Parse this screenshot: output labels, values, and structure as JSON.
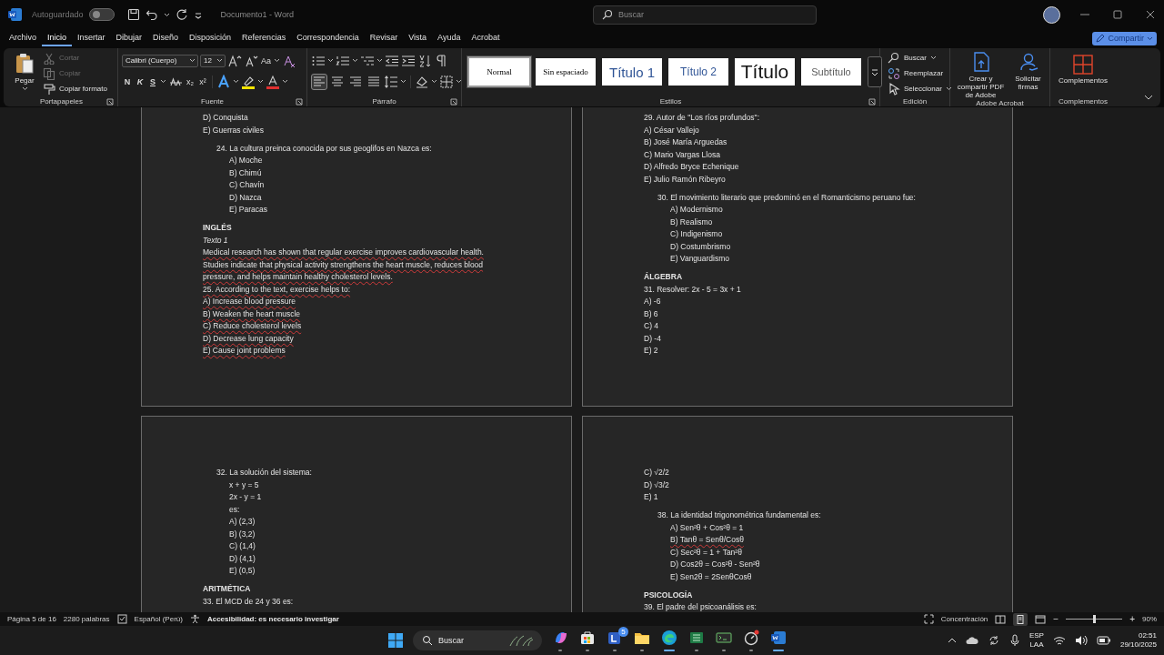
{
  "titlebar": {
    "autosave_label": "Autoguardado",
    "autosave_on": false,
    "title": "Documento1  -  Word",
    "search_placeholder": "Buscar"
  },
  "menu_tabs": [
    {
      "label": "Archivo",
      "selected": false
    },
    {
      "label": "Inicio",
      "selected": true
    },
    {
      "label": "Insertar",
      "selected": false
    },
    {
      "label": "Dibujar",
      "selected": false
    },
    {
      "label": "Diseño",
      "selected": false
    },
    {
      "label": "Disposición",
      "selected": false
    },
    {
      "label": "Referencias",
      "selected": false
    },
    {
      "label": "Correspondencia",
      "selected": false
    },
    {
      "label": "Revisar",
      "selected": false
    },
    {
      "label": "Vista",
      "selected": false
    },
    {
      "label": "Ayuda",
      "selected": false
    },
    {
      "label": "Acrobat",
      "selected": false
    }
  ],
  "share_button": "Compartir",
  "clipboard": {
    "title": "Portapapeles",
    "paste": "Pegar",
    "items": [
      {
        "label": "Cortar",
        "disabled": true
      },
      {
        "label": "Copiar",
        "disabled": true
      },
      {
        "label": "Copiar formato",
        "disabled": false
      }
    ]
  },
  "font": {
    "title": "Fuente",
    "font_name": "Calibri (Cuerpo)",
    "font_size": "12",
    "case_button": "Aa",
    "format_buttons": [
      "N",
      "K",
      "S"
    ],
    "script_buttons": [
      "x₂",
      "x²"
    ]
  },
  "paragraph": {
    "title": "Párrafo",
    "alignments": [
      {
        "kind": "left",
        "selected": true
      },
      {
        "kind": "center",
        "selected": false
      },
      {
        "kind": "right",
        "selected": false
      },
      {
        "kind": "justify",
        "selected": false
      }
    ]
  },
  "styles": {
    "title": "Estilos",
    "items": [
      {
        "label": "Normal",
        "kind": "normal",
        "selected": true
      },
      {
        "label": "Sin espaciado",
        "kind": "normal",
        "selected": false
      },
      {
        "label": "Título 1",
        "kind": "heading1",
        "selected": false
      },
      {
        "label": "Título 2",
        "kind": "heading2",
        "selected": false
      },
      {
        "label": "Título",
        "kind": "title",
        "selected": false
      },
      {
        "label": "Subtítulo",
        "kind": "subtitle",
        "selected": false
      }
    ]
  },
  "editing": {
    "title": "Edición",
    "items": [
      {
        "label": "Buscar",
        "kind": "find"
      },
      {
        "label": "Reemplazar",
        "kind": "replace"
      },
      {
        "label": "Seleccionar",
        "kind": "select"
      }
    ]
  },
  "acrobat": {
    "title": "Adobe Acrobat",
    "items": [
      {
        "label": "Crear y compartir PDF de Adobe",
        "kind": "pdf"
      },
      {
        "label": "Solicitar firmas",
        "kind": "sign"
      }
    ]
  },
  "addins": {
    "title": "Complementos",
    "button": "Complementos"
  },
  "pages": [
    {
      "lines": [
        {
          "text": "D) Conquista",
          "kind": "plain",
          "spell": false
        },
        {
          "text": "E) Guerras civiles",
          "kind": "plain",
          "spell": false
        },
        {
          "text": "24. La cultura preinca conocida por sus geoglifos en Nazca es:",
          "kind": "question",
          "spell": false
        },
        {
          "text": "A) Moche",
          "kind": "option",
          "spell": false
        },
        {
          "text": "B) Chimú",
          "kind": "option",
          "spell": false
        },
        {
          "text": "C) Chavín",
          "kind": "option",
          "spell": false
        },
        {
          "text": "D) Nazca",
          "kind": "option",
          "spell": false
        },
        {
          "text": "E) Paracas",
          "kind": "option",
          "spell": false
        },
        {
          "text": "INGLÉS",
          "kind": "heading",
          "spell": false
        },
        {
          "text": "Texto 1",
          "kind": "italic",
          "spell": false
        },
        {
          "text": "Medical research has shown that regular exercise improves cardiovascular health.",
          "kind": "plain",
          "spell": true
        },
        {
          "text": "Studies indicate that physical activity strengthens the heart muscle, reduces blood",
          "kind": "plain",
          "spell": true
        },
        {
          "text": "pressure, and helps maintain healthy cholesterol levels.",
          "kind": "plain",
          "spell": true
        },
        {
          "text": "25. According to the text, exercise helps to:",
          "kind": "plain",
          "spell": true
        },
        {
          "text": "A) Increase blood pressure",
          "kind": "plain",
          "spell": true
        },
        {
          "text": "B) Weaken the heart muscle",
          "kind": "plain",
          "spell": true
        },
        {
          "text": "C) Reduce cholesterol levels",
          "kind": "plain",
          "spell": true
        },
        {
          "text": "D) Decrease lung capacity",
          "kind": "plain",
          "spell": true
        },
        {
          "text": "E) Cause joint problems",
          "kind": "plain",
          "spell": true
        }
      ]
    },
    {
      "lines": [
        {
          "text": "29. Autor de \"Los ríos profundos\":",
          "kind": "plain",
          "spell": false
        },
        {
          "text": "A) César Vallejo",
          "kind": "plain",
          "spell": false
        },
        {
          "text": "B) José María Arguedas",
          "kind": "plain",
          "spell": false
        },
        {
          "text": "C) Mario Vargas Llosa",
          "kind": "plain",
          "spell": false
        },
        {
          "text": "D) Alfredo Bryce Echenique",
          "kind": "plain",
          "spell": false
        },
        {
          "text": "E) Julio Ramón Ribeyro",
          "kind": "plain",
          "spell": false
        },
        {
          "text": "30. El movimiento literario que predominó en el Romanticismo peruano fue:",
          "kind": "question",
          "spell": false
        },
        {
          "text": "A) Modernismo",
          "kind": "option",
          "spell": false
        },
        {
          "text": "B) Realismo",
          "kind": "option",
          "spell": false
        },
        {
          "text": "C) Indigenismo",
          "kind": "option",
          "spell": false
        },
        {
          "text": "D) Costumbrismo",
          "kind": "option",
          "spell": false
        },
        {
          "text": "E) Vanguardismo",
          "kind": "option",
          "spell": false
        },
        {
          "text": "ÁLGEBRA",
          "kind": "heading",
          "spell": false
        },
        {
          "text": "31. Resolver: 2x - 5 = 3x + 1",
          "kind": "plain",
          "spell": false
        },
        {
          "text": "A) -6",
          "kind": "plain",
          "spell": false
        },
        {
          "text": "B) 6",
          "kind": "plain",
          "spell": false
        },
        {
          "text": "C) 4",
          "kind": "plain",
          "spell": false
        },
        {
          "text": "D) -4",
          "kind": "plain",
          "spell": false
        },
        {
          "text": "E) 2",
          "kind": "plain",
          "spell": false
        }
      ]
    },
    {
      "lines": [
        {
          "text": "32. La solución del sistema:",
          "kind": "question",
          "spell": false
        },
        {
          "text": "x + y = 5",
          "kind": "option",
          "spell": false
        },
        {
          "text": "2x - y = 1",
          "kind": "option",
          "spell": false
        },
        {
          "text": "es:",
          "kind": "option",
          "spell": false
        },
        {
          "text": "A) (2,3)",
          "kind": "option",
          "spell": false
        },
        {
          "text": "B) (3,2)",
          "kind": "option",
          "spell": false
        },
        {
          "text": "C) (1,4)",
          "kind": "option",
          "spell": false
        },
        {
          "text": "D) (4,1)",
          "kind": "option",
          "spell": false
        },
        {
          "text": "E) (0,5)",
          "kind": "option",
          "spell": false
        },
        {
          "text": "ARITMÉTICA",
          "kind": "heading",
          "spell": false
        },
        {
          "text": "33. El MCD de 24 y 36 es:",
          "kind": "plain",
          "spell": false
        }
      ]
    },
    {
      "lines": [
        {
          "text": "C) √2/2",
          "kind": "plain",
          "spell": false
        },
        {
          "text": "D) √3/2",
          "kind": "plain",
          "spell": false
        },
        {
          "text": "E) 1",
          "kind": "plain",
          "spell": false
        },
        {
          "text": "38. La identidad trigonométrica fundamental es:",
          "kind": "question",
          "spell": false
        },
        {
          "text": "A) Sen²θ + Cos²θ = 1",
          "kind": "option",
          "spell": false
        },
        {
          "text": "B) Tanθ = Senθ/Cosθ",
          "kind": "option",
          "spell": true
        },
        {
          "text": "C) Sec²θ = 1 + Tan²θ",
          "kind": "option",
          "spell": false
        },
        {
          "text": "D) Cos2θ = Cos²θ - Sen²θ",
          "kind": "option",
          "spell": false
        },
        {
          "text": "E) Sen2θ = 2SenθCosθ",
          "kind": "option",
          "spell": false
        },
        {
          "text": "PSICOLOGÍA",
          "kind": "heading",
          "spell": false
        },
        {
          "text": "39. El padre del psicoanálisis es:",
          "kind": "plain",
          "spell": false
        }
      ]
    }
  ],
  "status_bar": {
    "page": "Página 5 de 16",
    "words": "2280 palabras",
    "language": "Español (Perú)",
    "accessibility": "Accesibilidad: es necesario investigar",
    "focus": "Concentración",
    "zoom_out": "−",
    "zoom_slider": {
      "level": 0.5
    },
    "zoom_in": "+",
    "zoom": "90%"
  },
  "taskbar": {
    "search_placeholder": "Buscar",
    "apps": [
      {
        "kind": "copilot",
        "active": false
      },
      {
        "kind": "store",
        "active": false
      },
      {
        "kind": "teams",
        "active": false,
        "badge": "5"
      },
      {
        "kind": "folder",
        "active": false
      },
      {
        "kind": "edge",
        "active": true
      },
      {
        "kind": "sheet",
        "active": false
      },
      {
        "kind": "terminal",
        "active": false
      },
      {
        "kind": "gauge",
        "active": false
      },
      {
        "kind": "word",
        "active": true
      }
    ],
    "language_top": "ESP",
    "language_bottom": "LAA",
    "time": "02:51",
    "date": "29/10/2025"
  }
}
